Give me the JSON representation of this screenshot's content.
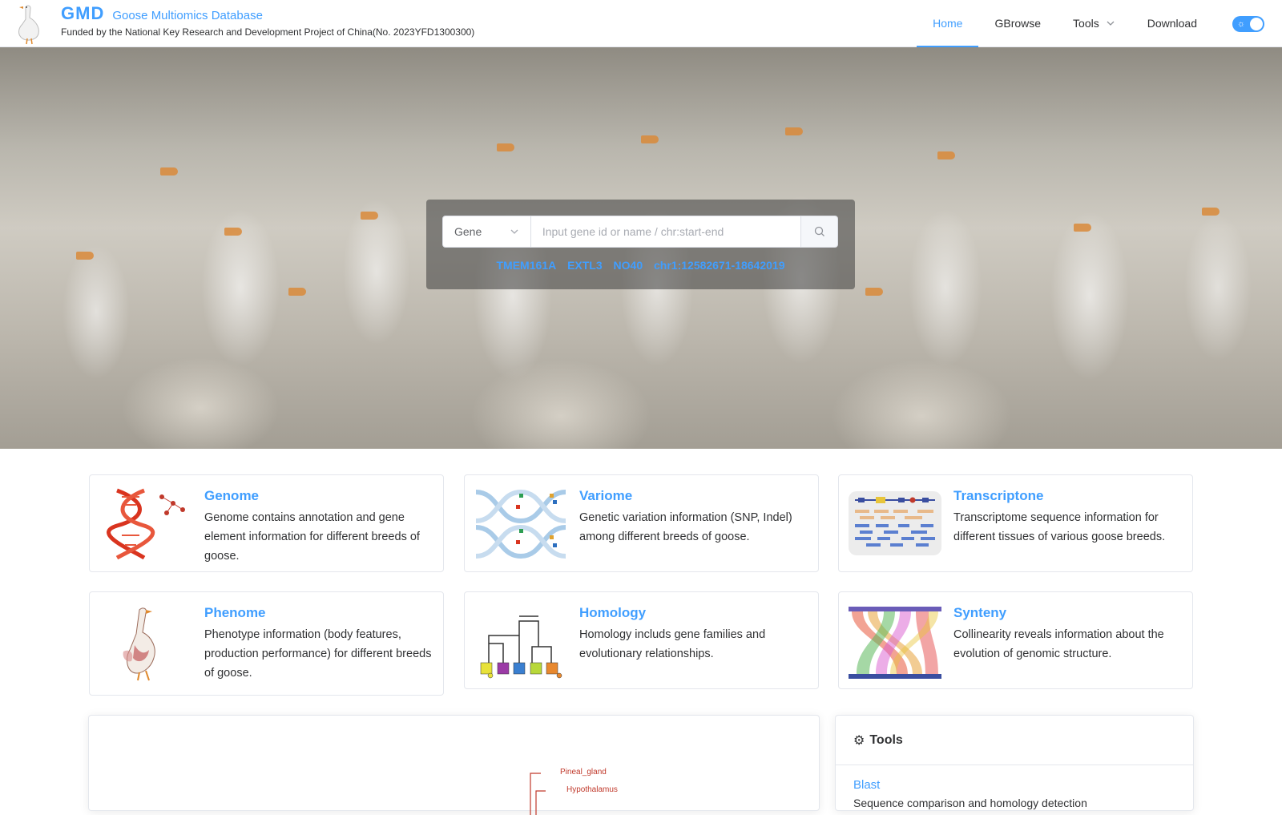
{
  "header": {
    "brand_short": "GMD",
    "brand_full": "Goose Multiomics Database",
    "funding": "Funded by the National Key Research and Development Project of China(No. 2023YFD1300300)",
    "nav": [
      {
        "label": "Home",
        "active": true
      },
      {
        "label": "GBrowse",
        "active": false
      },
      {
        "label": "Tools",
        "active": false,
        "dropdown": true
      },
      {
        "label": "Download",
        "active": false
      }
    ],
    "theme_toggle_icon": "sun-icon"
  },
  "search": {
    "type_selected": "Gene",
    "placeholder": "Input gene id or name / chr:start-end",
    "examples": [
      "TMEM161A",
      "EXTL3",
      "NO40",
      "chr1:12582671-18642019"
    ]
  },
  "cards": [
    {
      "title": "Genome",
      "desc": "Genome contains annotation and gene element information for different breeds of goose."
    },
    {
      "title": "Variome",
      "desc": "Genetic variation information (SNP, Indel) among different breeds of goose."
    },
    {
      "title": "Transcriptone",
      "desc": "Transcriptome sequence information for different tissues of various goose breeds."
    },
    {
      "title": "Phenome",
      "desc": "Phenotype information (body features, production performance) for different breeds of goose."
    },
    {
      "title": "Homology",
      "desc": "Homology includs gene families and evolutionary relationships."
    },
    {
      "title": "Synteny",
      "desc": "Collinearity reveals information about the evolution of genomic structure."
    }
  ],
  "tissue_tree": {
    "labels": [
      "Pineal_gland",
      "Hypothalamus"
    ]
  },
  "tools_panel": {
    "title": "Tools",
    "items": [
      {
        "label": "Blast",
        "desc": "Sequence comparison and homology detection"
      }
    ]
  },
  "colors": {
    "accent": "#409eff",
    "text": "#303133",
    "border": "#e4e7ed"
  }
}
